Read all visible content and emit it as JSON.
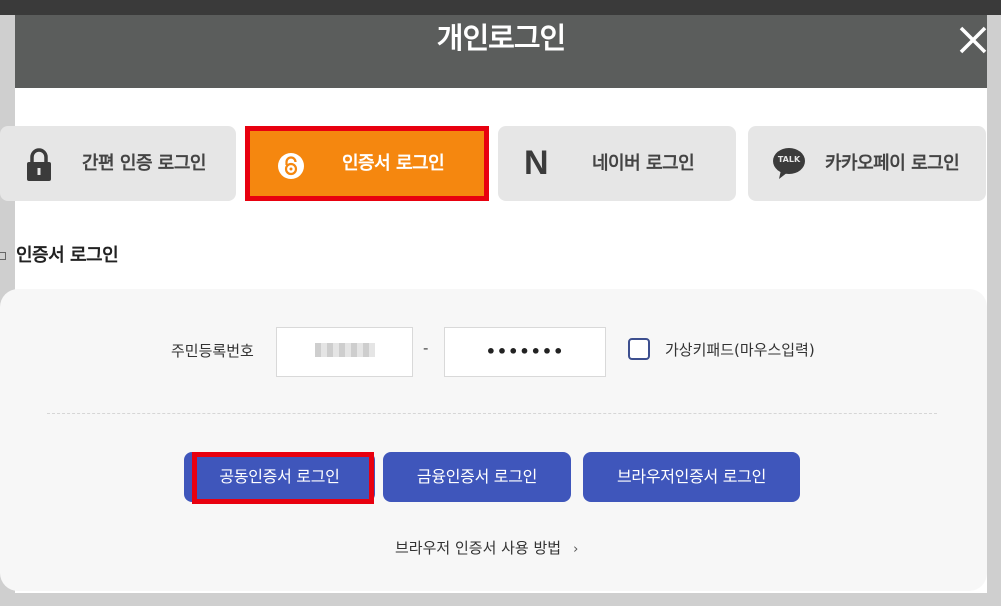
{
  "header": {
    "title": "개인로그인"
  },
  "tabs": [
    {
      "id": "simple",
      "label": "간편 인증 로그인",
      "icon": "lock-icon"
    },
    {
      "id": "cert",
      "label": "인증서 로그인",
      "icon": "certificate-icon",
      "selected": true
    },
    {
      "id": "naver",
      "label": "네이버 로그인",
      "icon": "naver-icon"
    },
    {
      "id": "kakao",
      "label": "카카오페이 로그인",
      "icon": "kakao-talk-icon",
      "icon_text": "TALK"
    }
  ],
  "naver_icon_text": "N",
  "section": {
    "title": "인증서 로그인"
  },
  "form": {
    "rrn_label": "주민등록번호",
    "rrn_dash": "-",
    "rrn_second_value": "•••••••",
    "virtual_keypad_label": "가상키패드(마우스입력)"
  },
  "buttons": {
    "joint_cert": "공동인증서 로그인",
    "financial_cert": "금융인증서 로그인",
    "browser_cert": "브라우저인증서 로그인"
  },
  "help": {
    "label": "브라우저 인증서 사용 방법",
    "chevron": "›"
  },
  "colors": {
    "header_bg": "#5b5d5c",
    "accent_orange": "#f5870f",
    "highlight_red": "#e8000f",
    "button_blue": "#3f56bb"
  }
}
